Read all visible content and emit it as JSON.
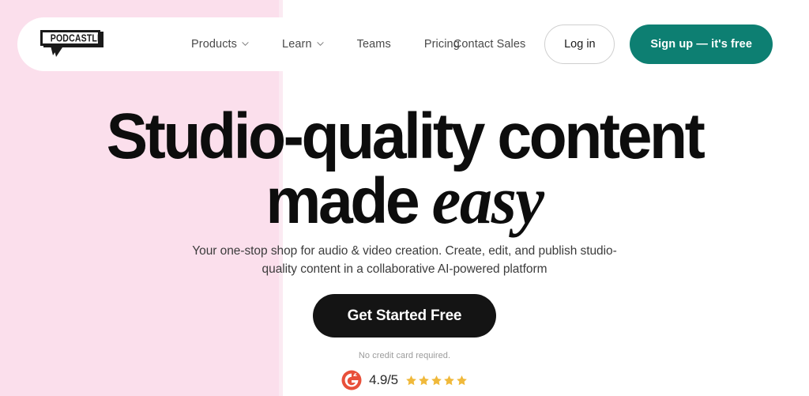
{
  "brand": {
    "logo_text": "PODCASTLE",
    "accent_teal": "#0d7f72",
    "background_pink": "#fbdfec",
    "cta_dark": "#141414",
    "g2_red": "#e8503a",
    "star_gold": "#f0b93b"
  },
  "header": {
    "nav": [
      {
        "label": "Products",
        "has_chevron": true,
        "icon": "chevron-down-icon"
      },
      {
        "label": "Learn",
        "has_chevron": true,
        "icon": "chevron-down-icon"
      },
      {
        "label": "Teams",
        "has_chevron": false
      },
      {
        "label": "Pricing",
        "has_chevron": false
      }
    ],
    "contact_sales": "Contact Sales",
    "login_label": "Log in",
    "signup_label": "Sign up — it's free"
  },
  "hero": {
    "headline_line1": "Studio-quality content",
    "headline_line2_bold": "made ",
    "headline_line2_italic": "easy",
    "subtitle": "Your one-stop shop for audio & video creation. Create, edit, and publish studio-quality content in a collaborative AI-powered platform",
    "cta_label": "Get Started Free",
    "no_credit_card": "No credit card required.",
    "rating": {
      "source_icon": "g2-logo-icon",
      "score": "4.9/5",
      "stars": 5
    }
  }
}
